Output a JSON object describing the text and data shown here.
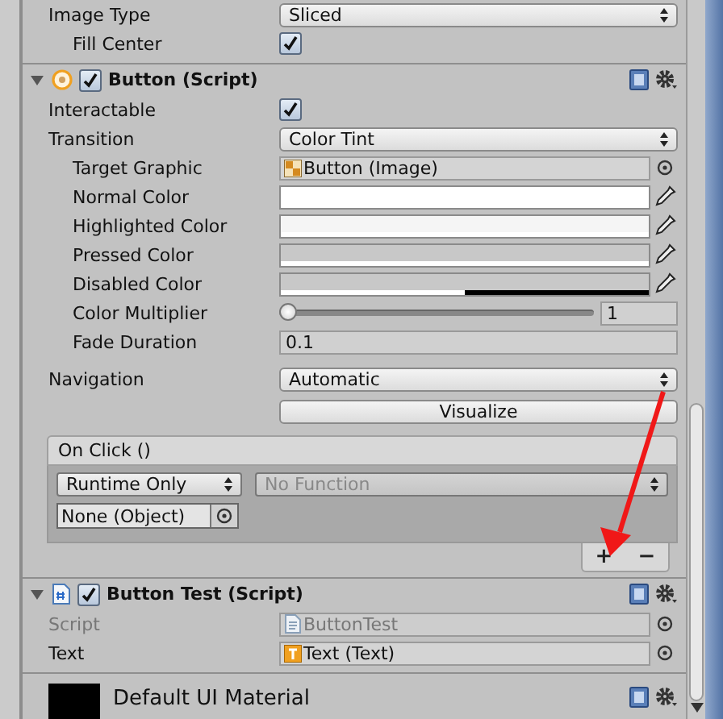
{
  "image_rows": [
    {
      "label": "Image Type",
      "kind": "dropdown",
      "value": "Sliced",
      "children": [
        {
          "label": "Fill Center",
          "kind": "checkbox",
          "checked": true
        }
      ]
    }
  ],
  "components": [
    {
      "title": "Button (Script)",
      "expanded": true,
      "enabled": true,
      "rows": [
        {
          "label": "Interactable",
          "kind": "checkbox",
          "checked": true
        },
        {
          "label": "Transition",
          "kind": "dropdown",
          "value": "Color Tint",
          "children": [
            {
              "label": "Target Graphic",
              "kind": "object",
              "value": "Button (Image)",
              "disabled": false
            },
            {
              "label": "Normal Color",
              "kind": "color",
              "color": "#ffffff",
              "level": 1
            },
            {
              "label": "Highlighted Color",
              "kind": "color",
              "color": "#f5f5f5",
              "level": 1
            },
            {
              "label": "Pressed Color",
              "kind": "color",
              "color": "#c8c8c8",
              "level": 1
            },
            {
              "label": "Disabled Color",
              "kind": "color",
              "color": "#c8c8c8",
              "level": 0.5
            },
            {
              "label": "Color Multiplier",
              "kind": "slider",
              "level": 0,
              "value": "1"
            },
            {
              "label": "Fade Duration",
              "kind": "number",
              "value": "0.1"
            }
          ]
        },
        {
          "label": "Navigation",
          "kind": "dropdown",
          "value": "Automatic"
        },
        {
          "label": "Visualize",
          "kind": "button"
        }
      ],
      "event": {
        "title": "On Click ()",
        "mode": "Runtime Only",
        "function": "No Function",
        "target": "None (Object)",
        "add": "+",
        "remove": "−"
      }
    },
    {
      "title": "Button Test (Script)",
      "expanded": true,
      "enabled": true,
      "rows": [
        {
          "label": "Script",
          "kind": "object",
          "value": "ButtonTest",
          "disabled": true
        },
        {
          "label": "Text",
          "kind": "object",
          "value": "Text (Text)",
          "disabled": false
        }
      ]
    }
  ],
  "material": {
    "name": "Default UI Material"
  }
}
